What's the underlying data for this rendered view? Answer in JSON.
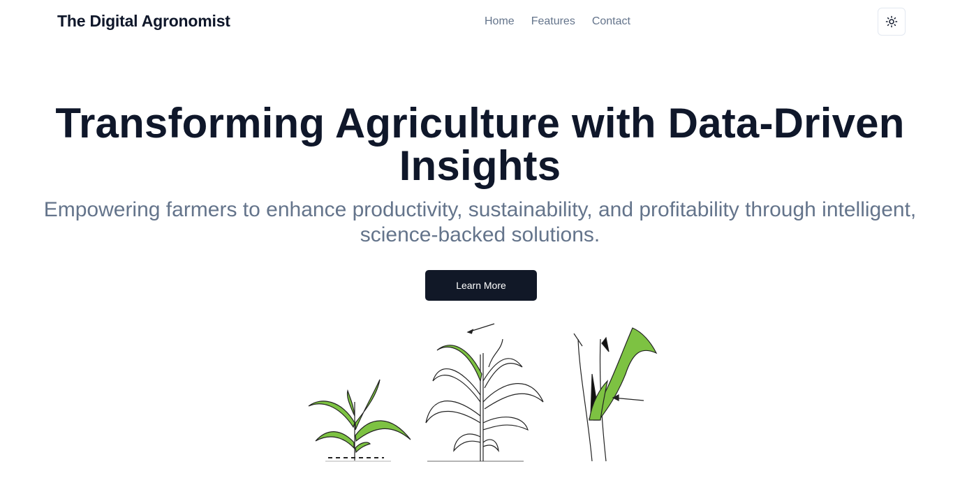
{
  "header": {
    "brand": "The Digital Agronomist",
    "nav": [
      "Home",
      "Features",
      "Contact"
    ],
    "theme_toggle_icon": "sun-icon"
  },
  "hero": {
    "title": "Transforming Agriculture with Data-Driven Insights",
    "subtitle": "Empowering farmers to enhance productivity, sustainability, and profitability through intelligent, science-backed solutions.",
    "cta_label": "Learn More"
  },
  "colors": {
    "text_dark": "#0f172a",
    "text_muted": "#64748b",
    "button_bg": "#111827",
    "leaf_green": "#7dc242"
  }
}
